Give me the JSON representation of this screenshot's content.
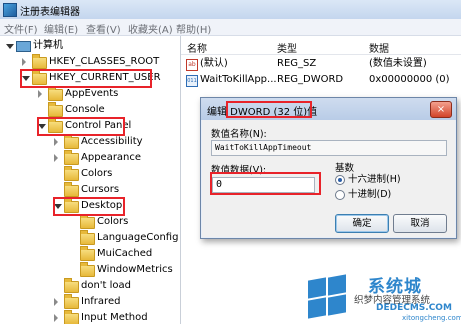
{
  "window": {
    "title": "注册表编辑器"
  },
  "menu": [
    "文件(F)",
    "编辑(E)",
    "查看(V)",
    "收藏夹(A)",
    "帮助(H)"
  ],
  "tree": {
    "root": "计算机",
    "nodes": [
      "HKEY_CLASSES_ROOT",
      "HKEY_CURRENT_USER",
      "AppEvents",
      "Console",
      "Control Panel",
      "Accessibility",
      "Appearance",
      "Colors",
      "Cursors",
      "Desktop",
      "Colors",
      "LanguageConfig",
      "MuiCached",
      "WindowMetrics",
      "don't load",
      "Infrared",
      "Input Method"
    ]
  },
  "list": {
    "columns": {
      "name": "名称",
      "type": "类型",
      "data": "数据"
    },
    "rows": [
      {
        "name": "(默认)",
        "type": "REG_SZ",
        "data": "(数值未设置)",
        "icon": "ab-string-icon"
      },
      {
        "name": "WaitToKillApp...",
        "type": "REG_DWORD",
        "data": "0x00000000 (0)",
        "icon": "binary-value-icon"
      }
    ]
  },
  "dialog": {
    "title": "编辑 DWORD (32 位)值",
    "close": "×",
    "value_name_label": "数值名称(N):",
    "value_name": "WaitToKillAppTimeout",
    "value_data_label": "数值数据(V):",
    "value_data": "0",
    "base_label": "基数",
    "hex_option": "十六进制(H)",
    "dec_option": "十进制(D)",
    "hex_selected": true,
    "ok": "确定",
    "cancel": "取消"
  },
  "watermark": {
    "name": "系统城",
    "slogan": "织梦内容管理系统",
    "domain": "DEDECMS.COM",
    "url": "xitongcheng.com"
  },
  "colors": {
    "highlight": "#e8232a",
    "accent": "#2e86cc"
  }
}
